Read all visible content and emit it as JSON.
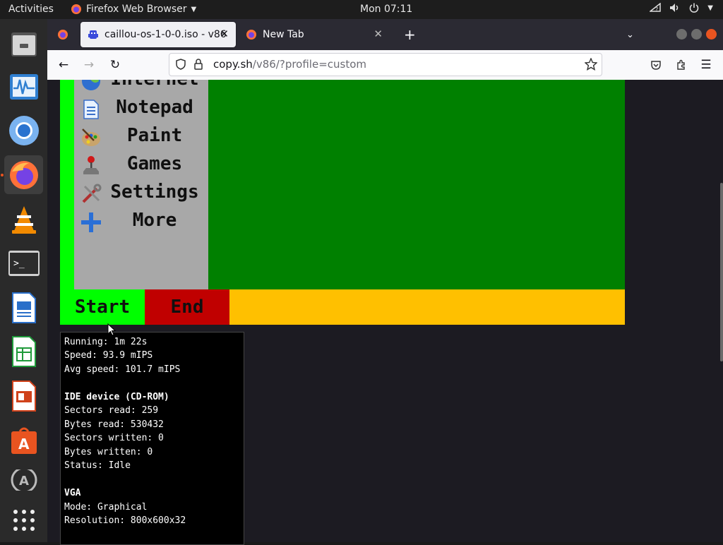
{
  "topbar": {
    "activities": "Activities",
    "app_name": "Firefox Web Browser",
    "clock": "Mon 07:11"
  },
  "dock": {
    "items": [
      "files-icon",
      "system-monitor-icon",
      "chromium-icon",
      "firefox-icon",
      "vlc-icon",
      "terminal-icon",
      "writer-icon",
      "calc-icon",
      "impress-icon",
      "software-center-icon",
      "update-icon",
      "app-grid-icon"
    ]
  },
  "browser": {
    "tabs": [
      {
        "title": "caillou-os-1-0-0.iso - v86",
        "selected": true
      },
      {
        "title": "New Tab",
        "selected": false
      }
    ],
    "url_host": "copy.sh",
    "url_path": "/v86/?profile=custom"
  },
  "vm": {
    "menu_items": [
      {
        "label": "Internet",
        "icon": "globe-icon"
      },
      {
        "label": "Notepad",
        "icon": "notepad-icon"
      },
      {
        "label": "Paint",
        "icon": "paint-palette-icon"
      },
      {
        "label": "Games",
        "icon": "joystick-icon"
      },
      {
        "label": "Settings",
        "icon": "tools-icon"
      },
      {
        "label": "More",
        "icon": "plus-icon"
      }
    ],
    "start_label": "Start",
    "end_label": "End",
    "colors": {
      "desktop": "#008000",
      "start": "#00ff00",
      "end": "#c00000",
      "taskbar": "#ffc000",
      "menu": "#a8a8a8"
    }
  },
  "stats": {
    "running": "Running: 1m 22s",
    "speed": "Speed: 93.9 mIPS",
    "avg_speed": "Avg speed: 101.7 mIPS",
    "ide_heading": "IDE device (CD-ROM)",
    "sectors_read": "Sectors read: 259",
    "bytes_read": "Bytes read: 530432",
    "sectors_written": "Sectors written: 0",
    "bytes_written": "Bytes written: 0",
    "status": "Status: Idle",
    "vga_heading": "VGA",
    "mode": "Mode: Graphical",
    "resolution": "Resolution: 800x600x32"
  }
}
